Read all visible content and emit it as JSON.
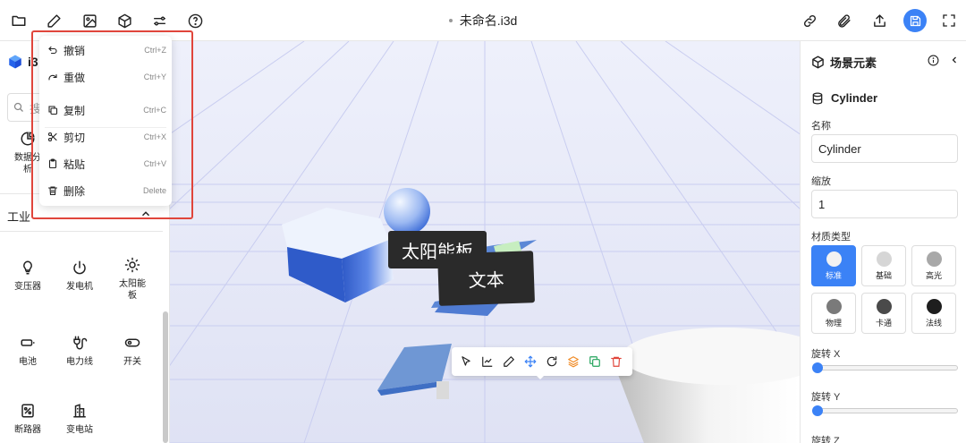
{
  "topbar": {
    "file_title": "未命名.i3d",
    "left_icons": [
      "folder-icon",
      "pencil-icon",
      "image-icon",
      "cube-icon",
      "sliders-icon",
      "help-icon"
    ],
    "right_icons": [
      "link-icon",
      "paperclip-icon",
      "share-icon",
      "save-icon",
      "fullscreen-icon"
    ]
  },
  "sidebar": {
    "logo_text": "i3",
    "search_placeholder": "搜",
    "top_item": {
      "label": "数据分析",
      "icon": "chart-icon"
    },
    "section": "工业",
    "items": [
      {
        "label": "变压器",
        "icon": "lightbulb-icon"
      },
      {
        "label": "发电机",
        "icon": "power-icon"
      },
      {
        "label": "太阳能板",
        "icon": "sun-icon"
      },
      {
        "label": "电池",
        "icon": "battery-icon"
      },
      {
        "label": "电力线",
        "icon": "cable-icon"
      },
      {
        "label": "开关",
        "icon": "toggle-icon"
      },
      {
        "label": "断路器",
        "icon": "breaker-icon"
      },
      {
        "label": "变电站",
        "icon": "substation-icon"
      }
    ]
  },
  "edit_menu": {
    "items": [
      {
        "label": "撤销",
        "shortcut": "Ctrl+Z",
        "icon": "undo-icon"
      },
      {
        "label": "重做",
        "shortcut": "Ctrl+Y",
        "icon": "redo-icon"
      },
      {
        "label": "复制",
        "shortcut": "Ctrl+C",
        "icon": "copy-icon"
      },
      {
        "label": "剪切",
        "shortcut": "Ctrl+X",
        "icon": "scissors-icon"
      },
      {
        "label": "粘贴",
        "shortcut": "Ctrl+V",
        "icon": "clipboard-icon"
      },
      {
        "label": "删除",
        "shortcut": "Delete",
        "icon": "trash-icon"
      }
    ]
  },
  "viewport": {
    "labels": [
      "太阳能板",
      "文本"
    ],
    "toolbar_icons": [
      "pointer-icon",
      "chart-line-icon",
      "pen-icon",
      "move-icon",
      "rotate-icon",
      "layers-icon",
      "duplicate-icon",
      "delete-icon"
    ]
  },
  "panel": {
    "title": "场景元素",
    "object_name": "Cylinder",
    "name_label": "名称",
    "name_value": "Cylinder",
    "scale_label": "缩放",
    "scale_value": "1",
    "material_label": "材质类型",
    "materials": [
      {
        "label": "标准",
        "color": "#f2f2f2"
      },
      {
        "label": "基础",
        "color": "#d6d6d6"
      },
      {
        "label": "高光",
        "color": "#a8a8a8"
      },
      {
        "label": "物理",
        "color": "#7a7a7a"
      },
      {
        "label": "卡通",
        "color": "#4a4a4a"
      },
      {
        "label": "法线",
        "color": "#1e1e1e"
      }
    ],
    "selected_material": 0,
    "rotate_x_label": "旋转 X",
    "rotate_y_label": "旋转 Y",
    "rotate_z_label": "旋转 Z",
    "rotate_x_value": 0,
    "rotate_y_value": 0
  },
  "colors": {
    "accent": "#3b82f6",
    "highlight_border": "#e0453b",
    "viewport_bg": "#e4e6f6"
  }
}
